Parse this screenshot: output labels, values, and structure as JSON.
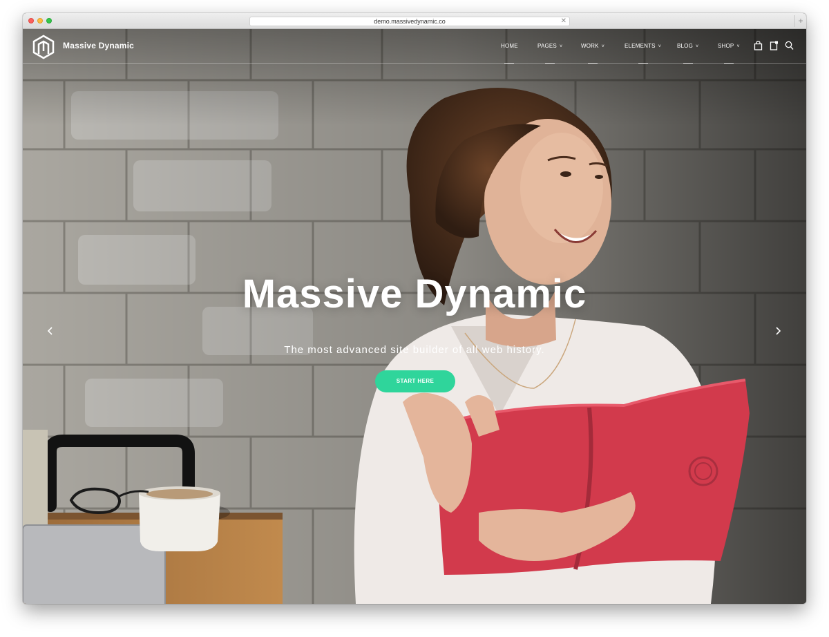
{
  "browser": {
    "url": "demo.massivedynamic.co",
    "new_tab_symbol": "+",
    "clear_symbol": "✕"
  },
  "site": {
    "brand": "Massive Dynamic",
    "nav": [
      {
        "label": "HOME",
        "has_dropdown": false
      },
      {
        "label": "PAGES",
        "has_dropdown": true
      },
      {
        "label": "WORK",
        "has_dropdown": true
      },
      {
        "label": "ELEMENTS",
        "has_dropdown": true
      },
      {
        "label": "BLOG",
        "has_dropdown": true
      },
      {
        "label": "SHOP",
        "has_dropdown": true
      }
    ],
    "dropdown_glyph": "˅",
    "header_icons": [
      "shopping-bag-icon",
      "notebook-icon",
      "search-icon"
    ]
  },
  "hero": {
    "title": "Massive Dynamic",
    "subtitle": "The most advanced site builder of all web history.",
    "cta_label": "START HERE",
    "slider_prev": "previous-slide-arrow-icon",
    "slider_next": "next-slide-arrow-icon"
  },
  "colors": {
    "accent": "#2fd59b",
    "text_on_image": "#ffffff",
    "notebook_red": "#d23a4c"
  }
}
